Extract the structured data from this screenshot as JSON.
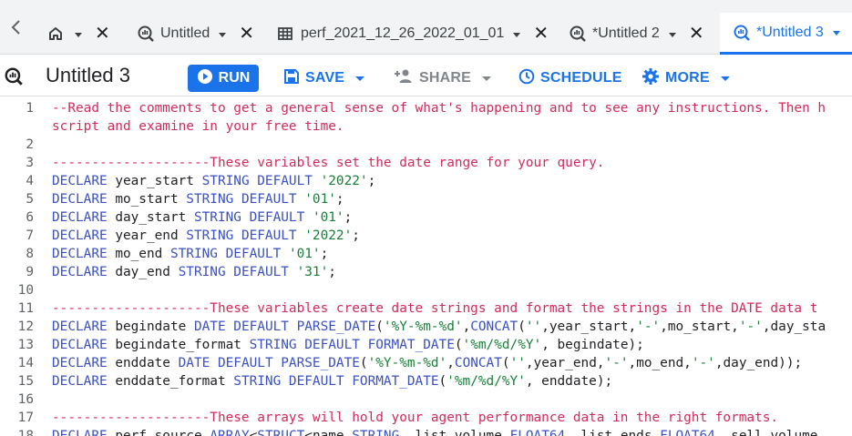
{
  "tabs": [
    {
      "label": "",
      "icon": "home-icon",
      "active": false
    },
    {
      "label": "Untitled",
      "icon": "query-icon",
      "active": false
    },
    {
      "label": "perf_2021_12_26_2022_01_01",
      "icon": "table-icon",
      "active": false
    },
    {
      "label": "*Untitled 2",
      "icon": "query-icon",
      "active": false
    },
    {
      "label": "*Untitled 3",
      "icon": "query-icon",
      "active": true
    }
  ],
  "toolbar": {
    "title": "Untitled 3",
    "run_label": "RUN",
    "save_label": "SAVE",
    "share_label": "SHARE",
    "schedule_label": "SCHEDULE",
    "more_label": "MORE"
  },
  "colors": {
    "accent": "#1a73e8",
    "comment": "#d02b5a",
    "keyword": "#3a50c4",
    "string": "#188038"
  },
  "editor": {
    "lines": [
      {
        "n": "1",
        "tokens": [
          [
            "c",
            "--Read the comments to get a general sense of what's happening and to see any instructions. Then h"
          ]
        ]
      },
      {
        "n": "",
        "tokens": [
          [
            "c",
            "script and examine in your free time."
          ]
        ]
      },
      {
        "n": "2",
        "tokens": []
      },
      {
        "n": "3",
        "tokens": [
          [
            "c",
            "--------------------These variables set the date range for your query."
          ]
        ]
      },
      {
        "n": "4",
        "tokens": [
          [
            "k",
            "DECLARE"
          ],
          [
            "p",
            " year_start "
          ],
          [
            "k",
            "STRING DEFAULT"
          ],
          [
            "p",
            " "
          ],
          [
            "s",
            "'2022'"
          ],
          [
            "p",
            ";"
          ]
        ]
      },
      {
        "n": "5",
        "tokens": [
          [
            "k",
            "DECLARE"
          ],
          [
            "p",
            " mo_start "
          ],
          [
            "k",
            "STRING DEFAULT"
          ],
          [
            "p",
            " "
          ],
          [
            "s",
            "'01'"
          ],
          [
            "p",
            ";"
          ]
        ]
      },
      {
        "n": "6",
        "tokens": [
          [
            "k",
            "DECLARE"
          ],
          [
            "p",
            " day_start "
          ],
          [
            "k",
            "STRING DEFAULT"
          ],
          [
            "p",
            " "
          ],
          [
            "s",
            "'01'"
          ],
          [
            "p",
            ";"
          ]
        ]
      },
      {
        "n": "7",
        "tokens": [
          [
            "k",
            "DECLARE"
          ],
          [
            "p",
            " year_end "
          ],
          [
            "k",
            "STRING DEFAULT"
          ],
          [
            "p",
            " "
          ],
          [
            "s",
            "'2022'"
          ],
          [
            "p",
            ";"
          ]
        ]
      },
      {
        "n": "8",
        "tokens": [
          [
            "k",
            "DECLARE"
          ],
          [
            "p",
            " mo_end "
          ],
          [
            "k",
            "STRING DEFAULT"
          ],
          [
            "p",
            " "
          ],
          [
            "s",
            "'01'"
          ],
          [
            "p",
            ";"
          ]
        ]
      },
      {
        "n": "9",
        "tokens": [
          [
            "k",
            "DECLARE"
          ],
          [
            "p",
            " day_end "
          ],
          [
            "k",
            "STRING DEFAULT"
          ],
          [
            "p",
            " "
          ],
          [
            "s",
            "'31'"
          ],
          [
            "p",
            ";"
          ]
        ]
      },
      {
        "n": "10",
        "tokens": []
      },
      {
        "n": "11",
        "tokens": [
          [
            "c",
            "--------------------These variables create date strings and format the strings in the DATE data t"
          ]
        ]
      },
      {
        "n": "12",
        "tokens": [
          [
            "k",
            "DECLARE"
          ],
          [
            "p",
            " begindate "
          ],
          [
            "k",
            "DATE DEFAULT PARSE_DATE"
          ],
          [
            "p",
            "("
          ],
          [
            "s",
            "'%Y-%m-%d'"
          ],
          [
            "p",
            ","
          ],
          [
            "k",
            "CONCAT"
          ],
          [
            "p",
            "("
          ],
          [
            "s",
            "''"
          ],
          [
            "p",
            ",year_start,"
          ],
          [
            "s",
            "'-'"
          ],
          [
            "p",
            ",mo_start,"
          ],
          [
            "s",
            "'-'"
          ],
          [
            "p",
            ",day_sta"
          ]
        ]
      },
      {
        "n": "13",
        "tokens": [
          [
            "k",
            "DECLARE"
          ],
          [
            "p",
            " begindate_format "
          ],
          [
            "k",
            "STRING DEFAULT FORMAT_DATE"
          ],
          [
            "p",
            "("
          ],
          [
            "s",
            "'%m/%d/%Y'"
          ],
          [
            "p",
            ", begindate);"
          ]
        ]
      },
      {
        "n": "14",
        "tokens": [
          [
            "k",
            "DECLARE"
          ],
          [
            "p",
            " enddate "
          ],
          [
            "k",
            "DATE DEFAULT PARSE_DATE"
          ],
          [
            "p",
            "("
          ],
          [
            "s",
            "'%Y-%m-%d'"
          ],
          [
            "p",
            ","
          ],
          [
            "k",
            "CONCAT"
          ],
          [
            "p",
            "("
          ],
          [
            "s",
            "''"
          ],
          [
            "p",
            ",year_end,"
          ],
          [
            "s",
            "'-'"
          ],
          [
            "p",
            ",mo_end,"
          ],
          [
            "s",
            "'-'"
          ],
          [
            "p",
            ",day_end));"
          ]
        ]
      },
      {
        "n": "15",
        "tokens": [
          [
            "k",
            "DECLARE"
          ],
          [
            "p",
            " enddate_format "
          ],
          [
            "k",
            "STRING DEFAULT FORMAT_DATE"
          ],
          [
            "p",
            "("
          ],
          [
            "s",
            "'%m/%d/%Y'"
          ],
          [
            "p",
            ", enddate);"
          ]
        ]
      },
      {
        "n": "16",
        "tokens": []
      },
      {
        "n": "17",
        "tokens": [
          [
            "c",
            "--------------------These arrays will hold your agent performance data in the right formats."
          ]
        ]
      },
      {
        "n": "18",
        "tokens": [
          [
            "k",
            "DECLARE"
          ],
          [
            "p",
            " perf_source "
          ],
          [
            "k",
            "ARRAY"
          ],
          [
            "p",
            "<"
          ],
          [
            "k",
            "STRUCT"
          ],
          [
            "p",
            "<name "
          ],
          [
            "k",
            "STRING"
          ],
          [
            "p",
            ", list_volume "
          ],
          [
            "k",
            "FLOAT64"
          ],
          [
            "p",
            ", list_ends "
          ],
          [
            "k",
            "FLOAT64"
          ],
          [
            "p",
            ", sell_volume"
          ]
        ]
      }
    ]
  }
}
